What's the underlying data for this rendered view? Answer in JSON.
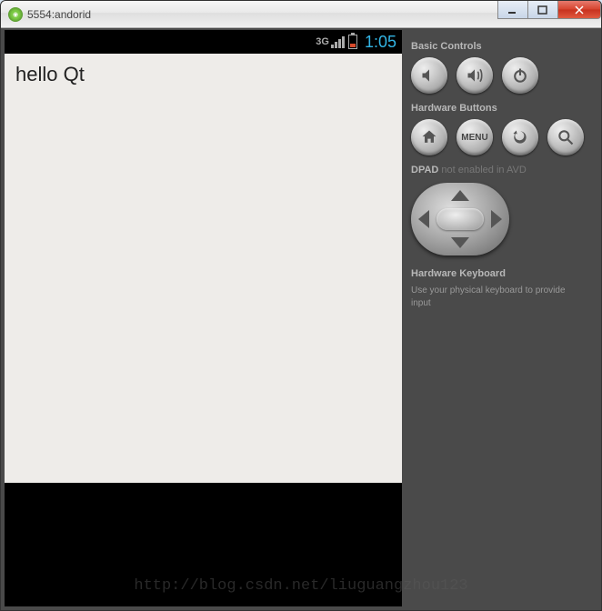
{
  "titlebar": {
    "title": "5554:andorid"
  },
  "statusbar": {
    "signal_label": "3G",
    "clock": "1:05"
  },
  "app": {
    "content_text": "hello Qt"
  },
  "side": {
    "basic_controls_heading": "Basic Controls",
    "hardware_buttons_heading": "Hardware Buttons",
    "menu_label": "MENU",
    "dpad_label": "DPAD",
    "dpad_note": " not enabled in AVD",
    "hk_heading": "Hardware Keyboard",
    "hk_note": "Use your physical keyboard to provide input"
  },
  "watermark": "http://blog.csdn.net/liuguangzhou123"
}
